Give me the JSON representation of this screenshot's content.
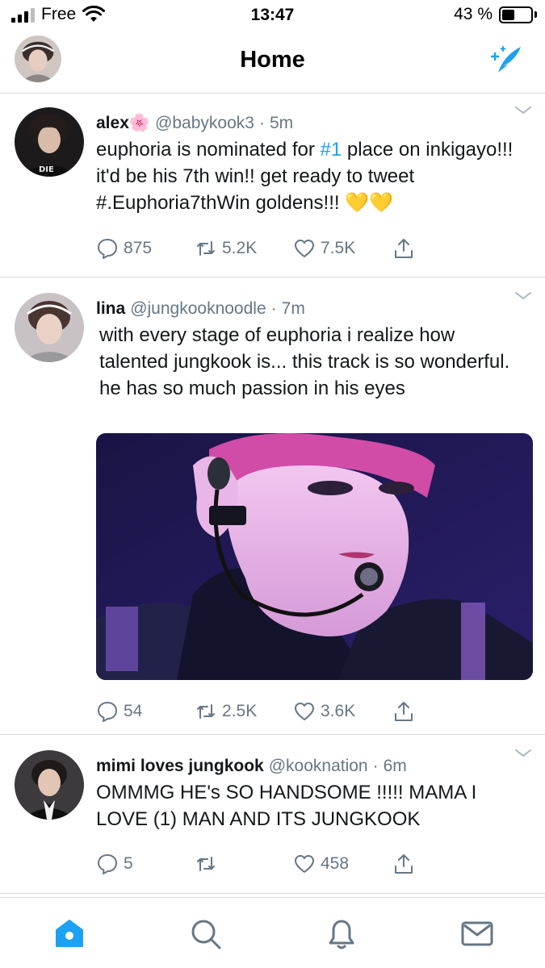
{
  "status_bar": {
    "carrier": "Free",
    "time": "13:47",
    "battery_percent": "43 %",
    "battery_level": 0.43
  },
  "header": {
    "title": "Home"
  },
  "tweets": [
    {
      "name": "alex",
      "name_emoji": "🌸",
      "handle": "@babykook3",
      "separator": "·",
      "time": "5m",
      "text_before": "euphoria is nominated for ",
      "hashtag": "#1",
      "text_after": " place on inkigayo!!! it'd be his 7th win!! get ready to tweet #.Euphoria7thWin goldens!!! 💛💛",
      "replies": "875",
      "retweets": "5.2K",
      "likes": "7.5K"
    },
    {
      "name": "lina",
      "handle": "@jungkooknoodle",
      "separator": "·",
      "time": "7m",
      "text": "with every stage of euphoria i realize how talented jungkook is... this track is so wonderful. he has so much passion in his eyes",
      "replies": "54",
      "retweets": "2.5K",
      "likes": "3.6K"
    },
    {
      "name": "mimi loves jungkook",
      "handle": "@kooknation",
      "separator": "·",
      "time": "6m",
      "text": "OMMMG HE's SO HANDSOME !!!!! MAMA I LOVE (1) MAN AND ITS JUNGKOOK",
      "replies": "5",
      "retweets": "",
      "likes": "458"
    }
  ],
  "colors": {
    "accent": "#1da1f2",
    "tab_active": "#1da1f2",
    "muted": "#657786",
    "divider": "#d9dde0",
    "text": "#14171a"
  },
  "icons": {
    "reply": "speech-bubble-icon",
    "retweet": "retweet-icon",
    "like": "heart-icon",
    "share": "share-icon",
    "compose": "compose-feather-icon",
    "tabs": [
      "home-icon",
      "search-icon",
      "bell-icon",
      "mail-icon"
    ]
  }
}
